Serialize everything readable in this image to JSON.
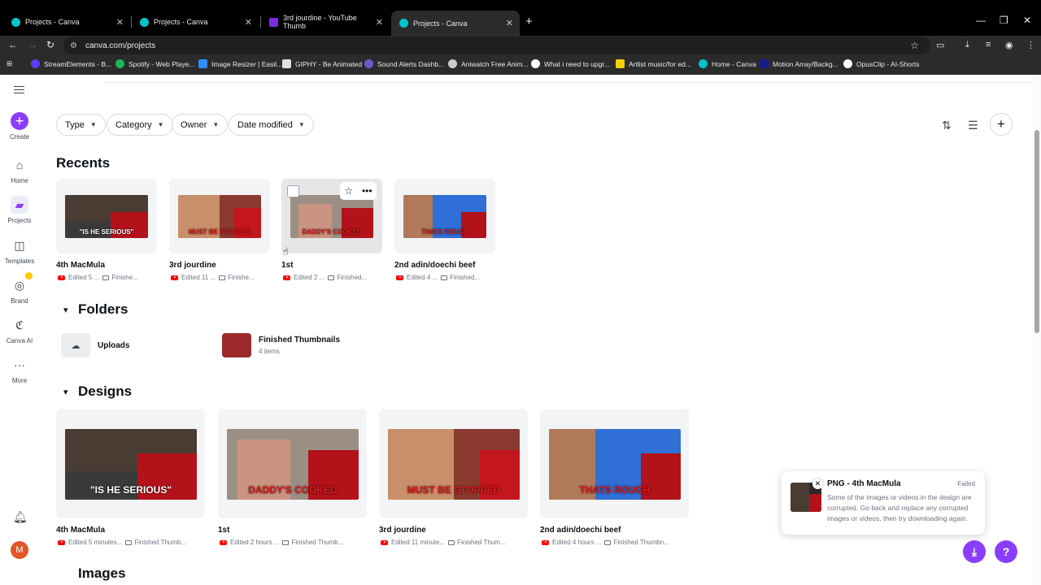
{
  "browser": {
    "tabs": [
      {
        "title": "Projects - Canva",
        "color": "#00c4cc"
      },
      {
        "title": "Projects - Canva",
        "color": "#00c4cc"
      },
      {
        "title": "3rd jourdine - YouTube Thumb",
        "color": "#7d2ae8"
      },
      {
        "title": "Projects - Canva",
        "color": "#00c4cc"
      }
    ],
    "url": "canva.com/projects",
    "bookmarks": [
      {
        "label": "StreamElements - B...",
        "color": "#5b3df5"
      },
      {
        "label": "Spotify - Web Playe...",
        "color": "#1db954"
      },
      {
        "label": "Image Resizer | Easil...",
        "color": "#2d8cff"
      },
      {
        "label": "GIPHY - Be Animated",
        "color": "#e0e0e0"
      },
      {
        "label": "Sound Alerts Dashb...",
        "color": "#6a5acd"
      },
      {
        "label": "Aniwatch Free Anim...",
        "color": "#cccccc"
      },
      {
        "label": "What i need to upgr...",
        "color": "#ffffff"
      },
      {
        "label": "Artlist music/for ed...",
        "color": "#f5d000"
      },
      {
        "label": "Home - Canva",
        "color": "#00c4cc"
      },
      {
        "label": "Motion Array/Backg...",
        "color": "#1a1a8a"
      },
      {
        "label": "OpusClip - AI-Shorts",
        "color": "#ffffff"
      }
    ]
  },
  "rail": {
    "create": "Create",
    "home": "Home",
    "projects": "Projects",
    "templates": "Templates",
    "brand": "Brand",
    "canva_ai": "Canva AI",
    "more": "More",
    "avatar_initial": "M"
  },
  "filters": {
    "type": "Type",
    "category": "Category",
    "owner": "Owner",
    "date": "Date modified"
  },
  "recents": {
    "title": "Recents",
    "items": [
      {
        "title": "4th MacMula",
        "edited": "Edited 5 ...",
        "folder": "Finishe...",
        "caption": "\"IS HE SERIOUS\""
      },
      {
        "title": "3rd jourdine",
        "edited": "Edited 11 ...",
        "folder": "Finishe...",
        "caption": "MUST BE STOPPED"
      },
      {
        "title": "1st",
        "edited": "Edited 2 ...",
        "folder": "Finished...",
        "caption": "DADDY'S COOKED"
      },
      {
        "title": "2nd adin/doechi beef",
        "edited": "Edited 4 ...",
        "folder": "Finished...",
        "caption": "THATS ROUGH"
      }
    ]
  },
  "folders": {
    "title": "Folders",
    "items": [
      {
        "name": "Uploads",
        "count": ""
      },
      {
        "name": "Finished Thumbnails",
        "count": "4 items"
      }
    ]
  },
  "designs": {
    "title": "Designs",
    "items": [
      {
        "title": "4th MacMula",
        "edited": "Edited 5 minutes...",
        "folder": "Finished Thumb...",
        "caption": "\"IS HE SERIOUS\""
      },
      {
        "title": "1st",
        "edited": "Edited 2 hours ...",
        "folder": "Finished Thumb...",
        "caption": "DADDY'S COOKED"
      },
      {
        "title": "3rd jourdine",
        "edited": "Edited 11 minute...",
        "folder": "Finished Thum...",
        "caption": "MUST BE STOPPED"
      },
      {
        "title": "2nd adin/doechi beef",
        "edited": "Edited 4 hours ...",
        "folder": "Finished Thumbn...",
        "caption": "THATS ROUGH"
      }
    ]
  },
  "images_section": "Images",
  "toast": {
    "title": "PNG - 4th MacMula",
    "status": "Failed",
    "message": "Some of the images or videos in the design are corrupted. Go back and replace any corrupted images or videos, then try downloading again."
  },
  "colors": {
    "accent": "#8b3dff",
    "youtube": "#ff0000"
  }
}
